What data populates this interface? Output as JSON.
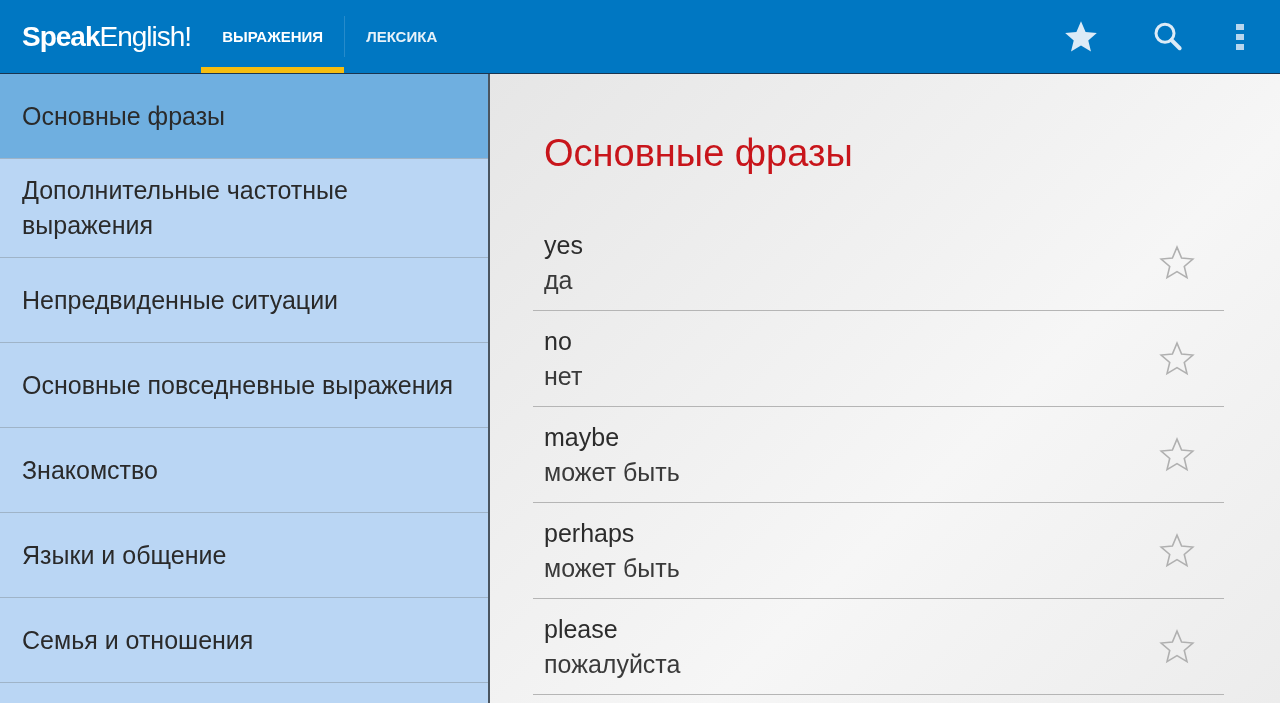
{
  "app_bar": {
    "logo": "**Speak**English!",
    "tabs": [
      {
        "label": "ВЫРАЖЕНИЯ",
        "selected": true
      },
      {
        "label": "ЛЕКСИКА",
        "selected": false
      }
    ]
  },
  "sidebar": {
    "items": [
      {
        "label": "Основные фразы",
        "selected": true
      },
      {
        "label": "Дополнительные частотные выражения",
        "selected": false
      },
      {
        "label": "Непредвиденные ситуации",
        "selected": false
      },
      {
        "label": "Основные повседневные выражения",
        "selected": false
      },
      {
        "label": "Знакомство",
        "selected": false
      },
      {
        "label": "Языки и общение",
        "selected": false
      },
      {
        "label": "Семья и отношения",
        "selected": false
      }
    ]
  },
  "content": {
    "title": "Основные фразы",
    "phrases": [
      {
        "english": "yes",
        "russian": "да",
        "favorite": false
      },
      {
        "english": "no",
        "russian": "нет",
        "favorite": false
      },
      {
        "english": "maybe",
        "russian": "может быть",
        "favorite": false
      },
      {
        "english": "perhaps",
        "russian": "может быть",
        "favorite": false
      },
      {
        "english": "please",
        "russian": "пожалуйста",
        "favorite": false
      }
    ]
  }
}
